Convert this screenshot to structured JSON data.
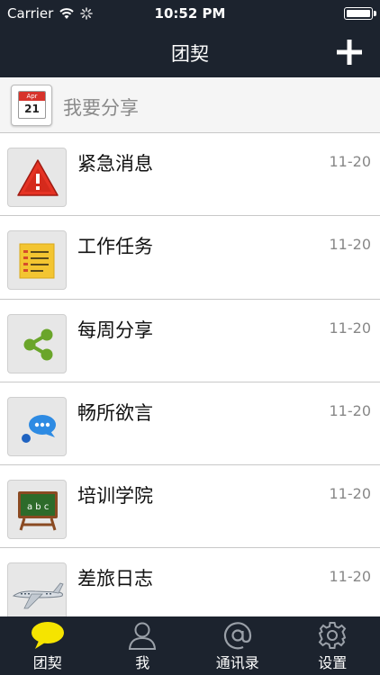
{
  "status_bar": {
    "carrier": "Carrier",
    "time": "10:52 PM"
  },
  "nav": {
    "title": "团契",
    "add_icon": "plus-icon"
  },
  "share": {
    "placeholder": "我要分享",
    "calendar_month": "Apr",
    "calendar_day": "21"
  },
  "items": [
    {
      "title": "紧急消息",
      "date": "11-20",
      "icon": "warning-icon"
    },
    {
      "title": "工作任务",
      "date": "11-20",
      "icon": "task-note-icon"
    },
    {
      "title": "每周分享",
      "date": "11-20",
      "icon": "share-icon"
    },
    {
      "title": "畅所欲言",
      "date": "11-20",
      "icon": "chat-bubbles-icon"
    },
    {
      "title": "培训学院",
      "date": "11-20",
      "icon": "chalkboard-icon"
    },
    {
      "title": "差旅日志",
      "date": "11-20",
      "icon": "airplane-icon"
    }
  ],
  "tabs": [
    {
      "label": "团契",
      "icon": "speech-bubble-icon",
      "active": true
    },
    {
      "label": "我",
      "icon": "user-icon",
      "active": false
    },
    {
      "label": "通讯录",
      "icon": "at-sign-icon",
      "active": false
    },
    {
      "label": "设置",
      "icon": "gear-icon",
      "active": false
    }
  ],
  "colors": {
    "bar_background": "#1c232e",
    "active_tab_icon": "#f5e400",
    "divider": "#c8c8c8"
  }
}
